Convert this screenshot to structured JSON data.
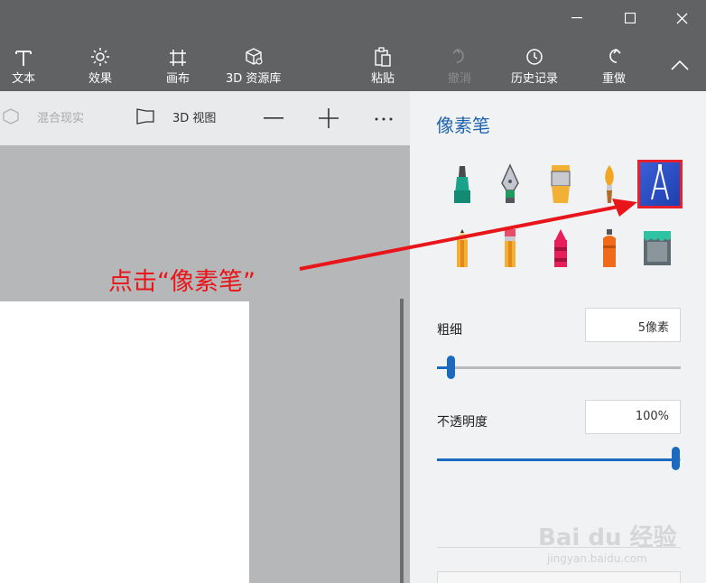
{
  "window": {
    "minimize_icon": "minimize-icon",
    "maximize_icon": "maximize-icon",
    "close_icon": "close-icon"
  },
  "ribbon": {
    "text": "文本",
    "effects": "效果",
    "canvas": "画布",
    "library": "3D 资源库",
    "paste": "粘贴",
    "undo": "撤消",
    "history": "历史记录",
    "redo": "重做"
  },
  "subbar": {
    "mixed_reality": "混合现实",
    "view_3d": "3D 视图"
  },
  "panel": {
    "title": "像素笔",
    "thickness_label": "粗细",
    "thickness_value": "5像素",
    "thickness_fraction": 0.06,
    "opacity_label": "不透明度",
    "opacity_value": "100%",
    "opacity_fraction": 1.0
  },
  "annotation": {
    "text": "点击“像素笔”"
  },
  "watermark": {
    "main": "Bai du 经验",
    "sub": "jingyan.baidu.com"
  }
}
